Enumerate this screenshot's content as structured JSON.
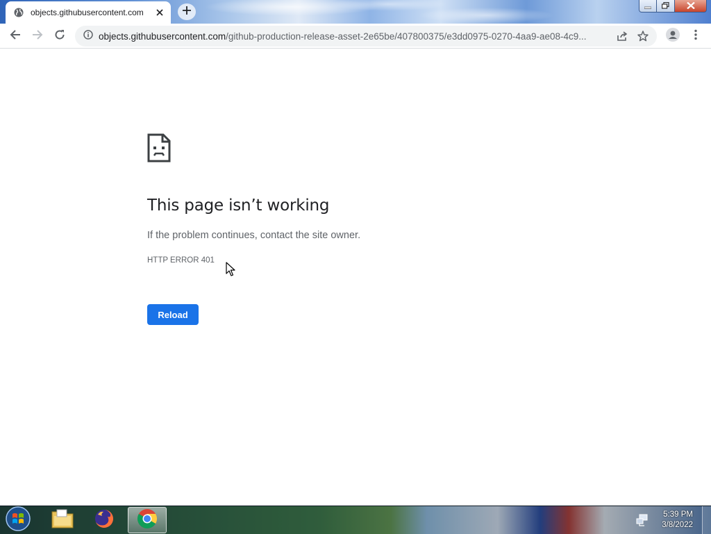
{
  "browser": {
    "tab": {
      "title": "objects.githubusercontent.com",
      "favicon": "globe-icon",
      "close_icon": "close-icon"
    },
    "new_tab_icon": "plus-icon",
    "window_controls": [
      "minimize-icon",
      "restore-icon",
      "close-icon"
    ],
    "toolbar": {
      "back_icon": "arrow-left-icon",
      "forward_icon": "arrow-right-icon",
      "reload_icon": "reload-icon",
      "site_info_icon": "info-icon",
      "url_host": "objects.githubusercontent.com",
      "url_path": "/github-production-release-asset-2e65be/407800375/e3dd0975-0270-4aa9-ae08-4c9...",
      "share_icon": "share-icon",
      "bookmark_icon": "star-icon",
      "profile_icon": "person-icon",
      "menu_icon": "kebab-menu-icon"
    }
  },
  "page": {
    "icon": "sad-document-icon",
    "heading": "This page isn’t working",
    "description": "If the problem continues, contact the site owner.",
    "error_code": "HTTP ERROR 401",
    "reload_label": "Reload",
    "accent_color": "#1a73e8"
  },
  "taskbar": {
    "start_icon": "windows-start-icon",
    "items": [
      "file-explorer-icon",
      "firefox-icon",
      "chrome-icon"
    ],
    "active_item": "chrome-icon",
    "tray_icon": "network-icon",
    "time": "5:39 PM",
    "date": "3/8/2022"
  }
}
